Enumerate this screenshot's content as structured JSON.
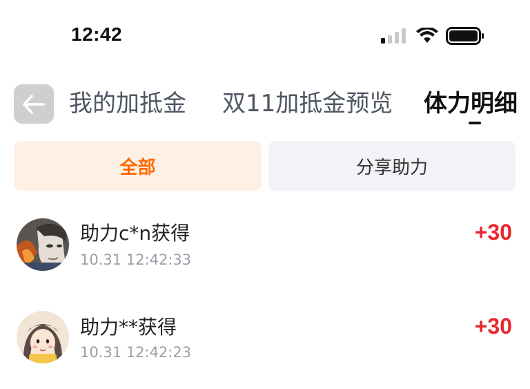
{
  "status_bar": {
    "time": "12:42"
  },
  "header": {
    "tabs": [
      {
        "label": "我的加抵金",
        "active": false
      },
      {
        "label": "双11加抵金预览",
        "active": false
      },
      {
        "label": "体力明细",
        "active": true
      }
    ]
  },
  "filters": [
    {
      "label": "全部",
      "active": true
    },
    {
      "label": "分享助力",
      "active": false
    }
  ],
  "records": [
    {
      "title": "助力c*n获得",
      "time": "10.31 12:42:33",
      "amount": "+30",
      "avatar_icon": "anime-male-avatar"
    },
    {
      "title": "助力**获得",
      "time": "10.31 12:42:23",
      "amount": "+30",
      "avatar_icon": "cartoon-girl-avatar"
    }
  ],
  "colors": {
    "accent": "#ff6a00",
    "accent_bg": "#fff0e6",
    "amount": "#e8262d",
    "muted": "#9aa0a8"
  }
}
